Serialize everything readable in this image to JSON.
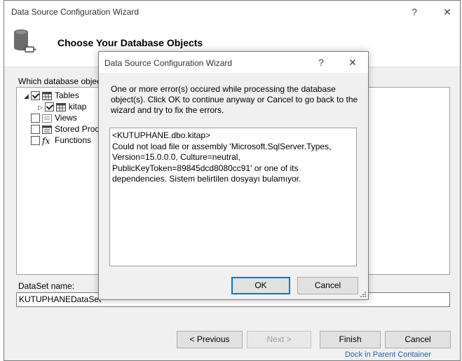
{
  "window": {
    "title": "Data Source Configuration Wizard",
    "help_glyph": "?",
    "close_glyph": "✕"
  },
  "header": {
    "title": "Choose Your Database Objects",
    "icon": "database-connection-icon"
  },
  "main": {
    "question": "Which database objec",
    "tree": [
      {
        "label": "Tables",
        "checked": true,
        "expanded": true,
        "icon": "tables-icon"
      },
      {
        "label": "kitap",
        "checked": true,
        "icon": "table-icon"
      },
      {
        "label": "Views",
        "checked": false,
        "icon": "views-icon"
      },
      {
        "label": "Stored Proc",
        "checked": false,
        "icon": "stored-procedures-icon"
      },
      {
        "label": "Functions",
        "checked": false,
        "icon": "function-icon"
      }
    ],
    "dataset_label": "DataSet name:",
    "dataset_value": "KUTUPHANEDataSet"
  },
  "buttons": {
    "previous": "< Previous",
    "next": "Next >",
    "finish": "Finish",
    "cancel": "Cancel"
  },
  "background_link": "Dock in Parent Container",
  "modal": {
    "title": "Data Source Configuration Wizard",
    "help_glyph": "?",
    "close_glyph": "✕",
    "message": "One or more error(s) occured while processing the database object(s). Click OK to continue anyway or Cancel to go back to the wizard and try to fix the errors.",
    "details": "<KUTUPHANE.dbo.kitap>\nCould not load file or assembly 'Microsoft.SqlServer.Types, Version=15.0.0.0, Culture=neutral, PublicKeyToken=89845dcd8080cc91' or one of its dependencies. Sistem belirtilen dosyayı bulamıyor.",
    "ok": "OK",
    "cancel": "Cancel"
  },
  "colors": {
    "accent": "#0078d7",
    "link": "#1e63b0"
  }
}
